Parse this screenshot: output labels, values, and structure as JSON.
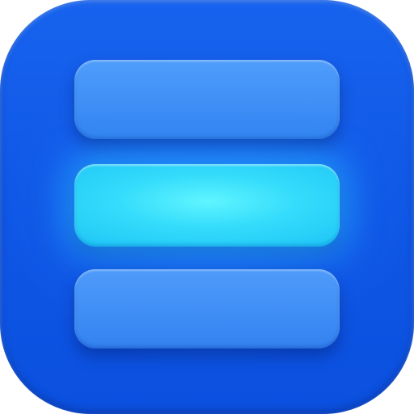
{
  "icon": {
    "name": "menu-bars-app-icon",
    "bars": [
      {
        "state": "default",
        "color": "#3f8ff6"
      },
      {
        "state": "highlighted",
        "color": "#35dcfb"
      },
      {
        "state": "default",
        "color": "#3f8ef5"
      }
    ],
    "colors": {
      "background": "#1360ea",
      "bar": "#3f8ff6",
      "highlight": "#35dcfb"
    }
  }
}
